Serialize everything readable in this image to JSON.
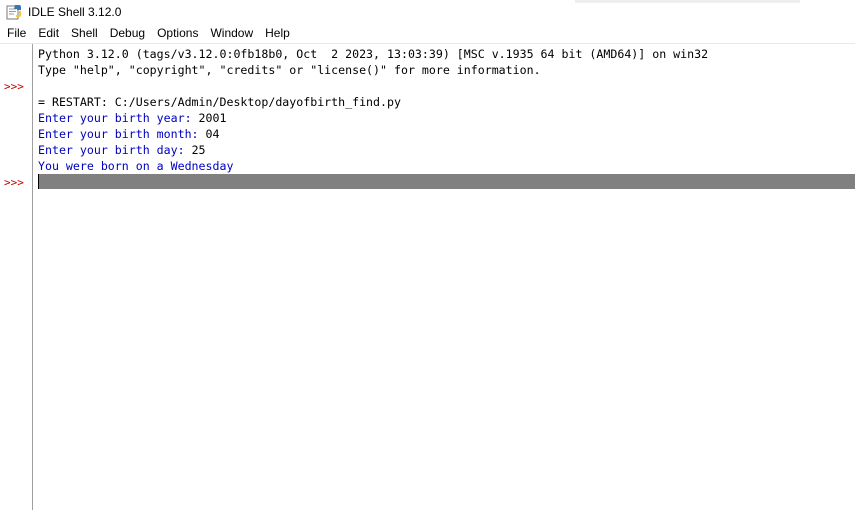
{
  "window": {
    "title": "IDLE Shell 3.12.0"
  },
  "menu": {
    "items": [
      "File",
      "Edit",
      "Shell",
      "Debug",
      "Options",
      "Window",
      "Help"
    ]
  },
  "gutter": {
    "prompt": ">>>"
  },
  "shell": {
    "banner_line1": "Python 3.12.0 (tags/v3.12.0:0fb18b0, Oct  2 2023, 13:03:39) [MSC v.1935 64 bit (AMD64)] on win32",
    "banner_line2": "Type \"help\", \"copyright\", \"credits\" or \"license()\" for more information.",
    "restart_line": "= RESTART: C:/Users/Admin/Desktop/dayofbirth_find.py",
    "prompt_year": "Enter your birth year: ",
    "value_year": "2001",
    "prompt_month": "Enter your birth month: ",
    "value_month": "04",
    "prompt_day": "Enter your birth day: ",
    "value_day": "25",
    "result_line": "You were born on a Wednesday"
  },
  "colors": {
    "prompt": "#c00000",
    "stdout": "#0000c0",
    "current_line": "#808080"
  }
}
